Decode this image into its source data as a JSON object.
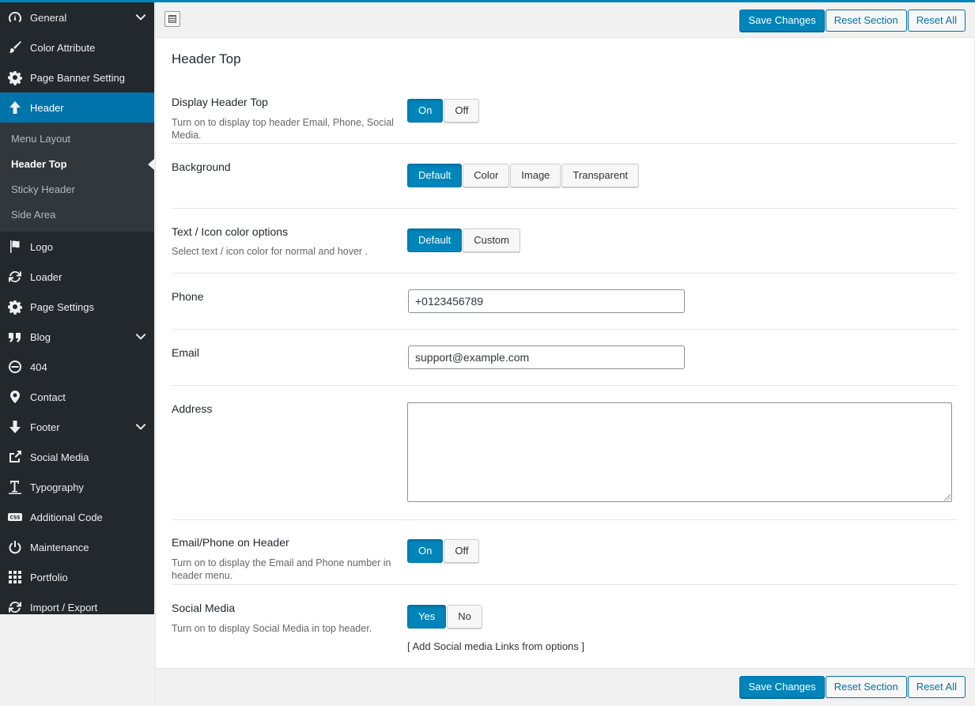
{
  "sidebar": {
    "items": [
      {
        "label": "General",
        "icon": "dashboard-gauge-icon",
        "chevron": true
      },
      {
        "label": "Color Attribute",
        "icon": "paintbrush-icon"
      },
      {
        "label": "Page Banner Setting",
        "icon": "gear-icon"
      },
      {
        "label": "Header",
        "icon": "arrow-up-icon",
        "active": true
      },
      {
        "label": "Logo",
        "icon": "flag-icon"
      },
      {
        "label": "Loader",
        "icon": "refresh-icon"
      },
      {
        "label": "Page Settings",
        "icon": "gear-icon"
      },
      {
        "label": "Blog",
        "icon": "quote-icon",
        "chevron": true
      },
      {
        "label": "404",
        "icon": "minus-circle-icon"
      },
      {
        "label": "Contact",
        "icon": "location-pin-icon"
      },
      {
        "label": "Footer",
        "icon": "arrow-down-icon",
        "chevron": true
      },
      {
        "label": "Social Media",
        "icon": "share-icon"
      },
      {
        "label": "Typography",
        "icon": "text-icon"
      },
      {
        "label": "Additional Code",
        "icon": "css-icon"
      },
      {
        "label": "Maintenance",
        "icon": "power-icon"
      },
      {
        "label": "Portfolio",
        "icon": "grid-icon"
      },
      {
        "label": "Import / Export",
        "icon": "sync-icon"
      }
    ],
    "subitems": [
      {
        "label": "Menu Layout"
      },
      {
        "label": "Header Top",
        "current": true
      },
      {
        "label": "Sticky Header"
      },
      {
        "label": "Side Area"
      }
    ]
  },
  "toolbar": {
    "save_label": "Save Changes",
    "reset_section_label": "Reset Section",
    "reset_all_label": "Reset All"
  },
  "section": {
    "title": "Header Top"
  },
  "fields": {
    "display_header_top": {
      "label": "Display Header Top",
      "desc": "Turn on to display top header Email, Phone, Social Media.",
      "options": [
        "On",
        "Off"
      ],
      "selected": "On"
    },
    "background": {
      "label": "Background",
      "options": [
        "Default",
        "Color",
        "Image",
        "Transparent"
      ],
      "selected": "Default"
    },
    "text_icon_color": {
      "label": "Text / Icon color options",
      "desc": "Select text / icon color for normal and hover .",
      "options": [
        "Default",
        "Custom"
      ],
      "selected": "Default"
    },
    "phone": {
      "label": "Phone",
      "value": "+0123456789"
    },
    "email": {
      "label": "Email",
      "value": "support@example.com"
    },
    "address": {
      "label": "Address",
      "value": ""
    },
    "email_phone_on_header": {
      "label": "Email/Phone on Header",
      "desc": "Turn on to display the Email and Phone number in header menu.",
      "options": [
        "On",
        "Off"
      ],
      "selected": "On"
    },
    "social_media": {
      "label": "Social Media",
      "desc": "Turn on to display Social Media in top header.",
      "options": [
        "Yes",
        "No"
      ],
      "selected": "Yes",
      "note": "[ Add Social media Links from options ]"
    }
  },
  "colors": {
    "accent": "#0085ba",
    "sidebar_bg": "#23282d",
    "submenu_bg": "#32373c",
    "active_bg": "#0073aa"
  }
}
